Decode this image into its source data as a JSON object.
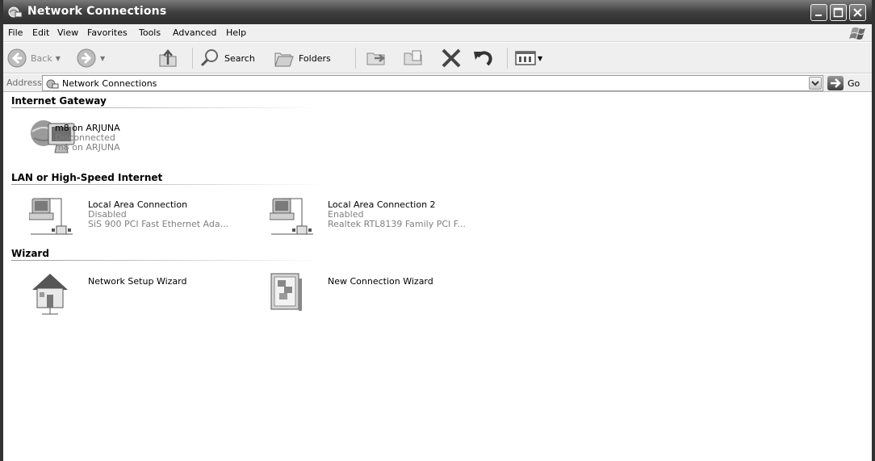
{
  "window": {
    "title": "Network Connections",
    "icon": "network-connections-icon",
    "buttons": [
      "minimize-icon",
      "maximize-icon",
      "close-icon"
    ]
  },
  "menu": {
    "items": [
      "File",
      "Edit",
      "View",
      "Favorites",
      "Tools",
      "Advanced",
      "Help"
    ]
  },
  "toolbar": {
    "back_label": "Back",
    "search_label": "Search",
    "folders_label": "Folders"
  },
  "address": {
    "label": "Address",
    "value": "Network Connections",
    "go_label": "Go"
  },
  "groups": {
    "internet_gateway": {
      "header": "Internet Gateway",
      "items": [
        {
          "name": "m8 on ARJUNA",
          "status": "Disconnected",
          "device": "m8 on ARJUNA"
        }
      ]
    },
    "lan": {
      "header": "LAN or High-Speed Internet",
      "items": [
        {
          "name": "Local Area Connection",
          "status": "Disabled",
          "device": "SiS 900 PCI Fast Ethernet Ada..."
        },
        {
          "name": "Local Area Connection 2",
          "status": "Enabled",
          "device": "Realtek RTL8139 Family PCI F..."
        }
      ]
    },
    "wizard": {
      "header": "Wizard",
      "items": [
        {
          "name": "Network Setup Wizard"
        },
        {
          "name": "New Connection Wizard"
        }
      ]
    }
  }
}
